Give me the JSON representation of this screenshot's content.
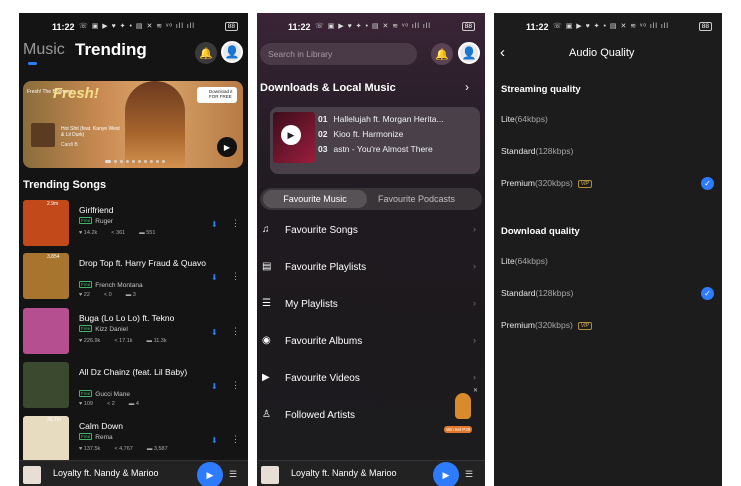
{
  "status_bar": {
    "time": "11:22",
    "icons": "☏ ▣ ▶ ♥ ✦ • ▤ ✕ ≋ ᵛᵒ ıll ıll",
    "battery": "88"
  },
  "screen1": {
    "tabs": {
      "music": "Music",
      "trending": "Trending"
    },
    "banner": {
      "brand": "Fresh! The Boomers",
      "title": "Fresh!",
      "song": "Hot Shit (feat. Kanye West & Lil Durk)",
      "artist": "Cardi B",
      "download_label": "Download it FOR FREE"
    },
    "section_title": "Trending Songs",
    "songs": [
      {
        "title": "Girlfriend",
        "artist": "Ruger",
        "plays": "2.9m",
        "likes": "14.2k",
        "shares": "361",
        "comments": "551",
        "cover_color": "#c24a1a"
      },
      {
        "title": "Drop Top ft. Harry Fraud & Quavo",
        "artist": "French Montana",
        "plays": "3,854",
        "likes": "22",
        "shares": "0",
        "comments": "3",
        "cover_color": "#a8752e"
      },
      {
        "title": "Buga (Lo Lo Lo) ft. Tekno",
        "artist": "Kizz Daniel",
        "plays": "",
        "likes": "226.9k",
        "shares": "17.1k",
        "comments": "11.3k",
        "cover_color": "#b64f8f"
      },
      {
        "title": "All Dz Chainz (feat. Lil Baby)",
        "artist": "Gucci Mane",
        "plays": "",
        "likes": "109",
        "shares": "2",
        "comments": "4",
        "cover_color": "#3b4a2e"
      },
      {
        "title": "Calm Down",
        "artist": "Rema",
        "plays": "35.7m",
        "likes": "137.5k",
        "shares": "4,767",
        "comments": "3,587",
        "cover_color": "#e8dcc0"
      }
    ],
    "free_badge": "Free",
    "player_title": "Loyalty ft. Nandy & Marioo"
  },
  "screen2": {
    "search_placeholder": "Search in Library",
    "downloads_title": "Downloads & Local Music",
    "tracks": [
      {
        "num": "01",
        "name": "Hallelujah ft. Morgan Herita..."
      },
      {
        "num": "02",
        "name": "Kioo ft. Harmonize"
      },
      {
        "num": "03",
        "name": "astn - You're Almost There"
      }
    ],
    "segments": {
      "active": "Favourite Music",
      "inactive": "Favourite Podcasts"
    },
    "menu": [
      {
        "label": "Favourite Songs",
        "icon": "♫"
      },
      {
        "label": "Favourite Playlists",
        "icon": "▤"
      },
      {
        "label": "My Playlists",
        "icon": "☰"
      },
      {
        "label": "Favourite Albums",
        "icon": "◉"
      },
      {
        "label": "Favourite Videos",
        "icon": "▶"
      },
      {
        "label": "Followed Artists",
        "icon": "♙"
      }
    ],
    "promo_label": "Win Itel P38",
    "player_title": "Loyalty ft. Nandy & Marioo"
  },
  "screen3": {
    "title": "Audio Quality",
    "streaming": {
      "heading": "Streaming quality",
      "options": [
        {
          "name": "Lite",
          "kbps": "(64kbps)",
          "vip": false,
          "selected": false
        },
        {
          "name": "Standard",
          "kbps": "(128kbps)",
          "vip": false,
          "selected": false
        },
        {
          "name": "Premium",
          "kbps": "(320kbps)",
          "vip": true,
          "selected": true
        }
      ]
    },
    "download": {
      "heading": "Download quality",
      "options": [
        {
          "name": "Lite",
          "kbps": "(64kbps)",
          "vip": false,
          "selected": false
        },
        {
          "name": "Standard",
          "kbps": "(128kbps)",
          "vip": false,
          "selected": true
        },
        {
          "name": "Premium",
          "kbps": "(320kbps)",
          "vip": true,
          "selected": false
        }
      ]
    },
    "vip_label": "VIP"
  },
  "colors": {
    "accent": "#2d7bff",
    "free_green": "#3fb36a",
    "vip_gold": "#d9b25b"
  }
}
